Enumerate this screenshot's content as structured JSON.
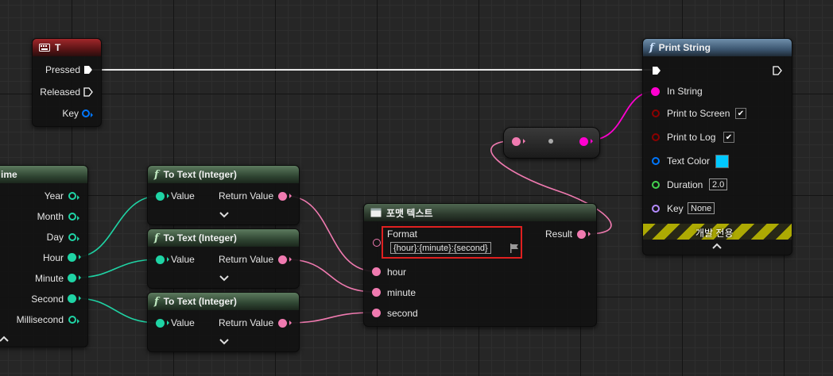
{
  "key_node": {
    "title": "T",
    "icon": "keyboard-icon",
    "header_color": "#a1272a",
    "pins": {
      "pressed": "Pressed",
      "released": "Released",
      "key": "Key"
    }
  },
  "datetime_node": {
    "title_partial": "ime",
    "pins": [
      "Year",
      "Month",
      "Day",
      "Hour",
      "Minute",
      "Second",
      "Millisecond"
    ],
    "collapse_icon": "chevron-up-icon"
  },
  "to_text_nodes": [
    {
      "title": "To Text (Integer)",
      "input": "Value",
      "output": "Return Value"
    },
    {
      "title": "To Text (Integer)",
      "input": "Value",
      "output": "Return Value"
    },
    {
      "title": "To Text (Integer)",
      "input": "Value",
      "output": "Return Value"
    }
  ],
  "format_node": {
    "title": "포맷 텍스트",
    "icon": "format-text-icon",
    "format_label": "Format",
    "format_value": "{hour}:{minute}:{second}",
    "format_highlight_color": "#e02020",
    "result_label": "Result",
    "args": [
      "hour",
      "minute",
      "second"
    ]
  },
  "print_node": {
    "title": "Print String",
    "header_color": "#3c5670",
    "in_string": "In String",
    "print_to_screen": "Print to Screen",
    "print_to_screen_checked": true,
    "print_to_log": "Print to Log",
    "print_to_log_checked": true,
    "text_color": "Text Color",
    "text_color_value": "#00c8ff",
    "duration": "Duration",
    "duration_value": "2.0",
    "key": "Key",
    "key_value": "None",
    "dev_only": "개발 전용"
  },
  "colors": {
    "exec_wire": "#e8e8e8",
    "int_pin": "#1fd4a5",
    "text_pin": "#f07ab0",
    "string_pin": "#ff00d0",
    "bool_pin": "#8b0000",
    "struct_pin": "#0077ff",
    "float_pin": "#44d34f",
    "name_pin": "#b58cff"
  }
}
